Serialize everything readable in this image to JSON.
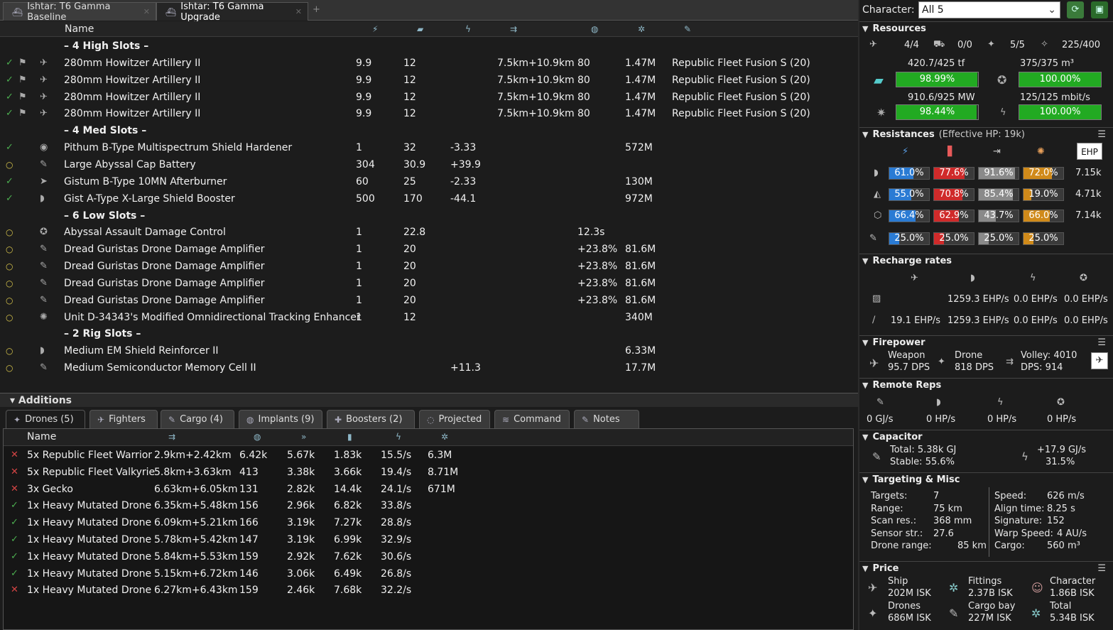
{
  "tabs": [
    {
      "label": "Ishtar: T6 Gamma Baseline"
    },
    {
      "label": "Ishtar: T6 Gamma Upgrade"
    }
  ],
  "fit_header": {
    "name": "Name"
  },
  "sections": {
    "high": "– 4 High Slots –",
    "med": "– 4 Med Slots –",
    "low": "– 6 Low Slots –",
    "rig": "– 2 Rig Slots –"
  },
  "modules": [
    {
      "state": "✓",
      "name": "280mm Howitzer Artillery II",
      "c1": "9.9",
      "c2": "12",
      "c3": "",
      "c4": "7.5km+10.9km",
      "c5": "80",
      "c6": "1.47M",
      "c7": "Republic Fleet Fusion S (20)"
    },
    {
      "state": "✓",
      "name": "280mm Howitzer Artillery II",
      "c1": "9.9",
      "c2": "12",
      "c3": "",
      "c4": "7.5km+10.9km",
      "c5": "80",
      "c6": "1.47M",
      "c7": "Republic Fleet Fusion S (20)"
    },
    {
      "state": "✓",
      "name": "280mm Howitzer Artillery II",
      "c1": "9.9",
      "c2": "12",
      "c3": "",
      "c4": "7.5km+10.9km",
      "c5": "80",
      "c6": "1.47M",
      "c7": "Republic Fleet Fusion S (20)"
    },
    {
      "state": "✓",
      "name": "280mm Howitzer Artillery II",
      "c1": "9.9",
      "c2": "12",
      "c3": "",
      "c4": "7.5km+10.9km",
      "c5": "80",
      "c6": "1.47M",
      "c7": "Republic Fleet Fusion S (20)"
    },
    {
      "state": "✓",
      "name": "Pithum B-Type Multispectrum Shield Hardener",
      "c1": "1",
      "c2": "32",
      "c3": "-3.33",
      "c4": "",
      "c5": "",
      "c6": "572M",
      "c7": ""
    },
    {
      "state": "○",
      "name": "Large Abyssal Cap Battery",
      "c1": "304",
      "c2": "30.9",
      "c3": "+39.9",
      "c4": "",
      "c5": "",
      "c6": "",
      "c7": ""
    },
    {
      "state": "✓",
      "name": "Gistum B-Type 10MN Afterburner",
      "c1": "60",
      "c2": "25",
      "c3": "-2.33",
      "c4": "",
      "c5": "",
      "c6": "130M",
      "c7": ""
    },
    {
      "state": "✓",
      "name": "Gist A-Type X-Large Shield Booster",
      "c1": "500",
      "c2": "170",
      "c3": "-44.1",
      "c4": "",
      "c5": "",
      "c6": "972M",
      "c7": ""
    },
    {
      "state": "○",
      "name": "Abyssal Assault Damage Control",
      "c1": "1",
      "c2": "22.8",
      "c3": "",
      "c4": "",
      "c5": "12.3s",
      "c6": "",
      "c7": ""
    },
    {
      "state": "○",
      "name": "Dread Guristas Drone Damage Amplifier",
      "c1": "1",
      "c2": "20",
      "c3": "",
      "c4": "",
      "c5": "+23.8%",
      "c6": "81.6M",
      "c7": ""
    },
    {
      "state": "○",
      "name": "Dread Guristas Drone Damage Amplifier",
      "c1": "1",
      "c2": "20",
      "c3": "",
      "c4": "",
      "c5": "+23.8%",
      "c6": "81.6M",
      "c7": ""
    },
    {
      "state": "○",
      "name": "Dread Guristas Drone Damage Amplifier",
      "c1": "1",
      "c2": "20",
      "c3": "",
      "c4": "",
      "c5": "+23.8%",
      "c6": "81.6M",
      "c7": ""
    },
    {
      "state": "○",
      "name": "Dread Guristas Drone Damage Amplifier",
      "c1": "1",
      "c2": "20",
      "c3": "",
      "c4": "",
      "c5": "+23.8%",
      "c6": "81.6M",
      "c7": ""
    },
    {
      "state": "○",
      "name": "Unit D-34343's Modified Omnidirectional Tracking Enhancer",
      "c1": "1",
      "c2": "12",
      "c3": "",
      "c4": "",
      "c5": "",
      "c6": "340M",
      "c7": ""
    },
    {
      "state": "○",
      "name": "Medium EM Shield Reinforcer II",
      "c1": "",
      "c2": "",
      "c3": "",
      "c4": "",
      "c5": "",
      "c6": "6.33M",
      "c7": ""
    },
    {
      "state": "○",
      "name": "Medium Semiconductor Memory Cell II",
      "c1": "",
      "c2": "",
      "c3": "+11.3",
      "c4": "",
      "c5": "",
      "c6": "17.7M",
      "c7": ""
    }
  ],
  "additions": {
    "title": "Additions",
    "tabs": [
      "Drones (5)",
      "Fighters",
      "Cargo (4)",
      "Implants (9)",
      "Boosters (2)",
      "Projected",
      "Command",
      "Notes"
    ],
    "name_header": "Name",
    "drones": [
      {
        "state": "✕",
        "name": "5x Republic Fleet Warrior",
        "range": "2.9km+2.42km",
        "c1": "6.42k",
        "c2": "5.67k",
        "c3": "1.83k",
        "c4": "15.5/s",
        "c5": "6.3M"
      },
      {
        "state": "✕",
        "name": "5x Republic Fleet Valkyrie",
        "range": "5.8km+3.63km",
        "c1": "413",
        "c2": "3.38k",
        "c3": "3.66k",
        "c4": "19.4/s",
        "c5": "8.71M"
      },
      {
        "state": "✕",
        "name": "3x Gecko",
        "range": "6.63km+6.05km",
        "c1": "131",
        "c2": "2.82k",
        "c3": "14.4k",
        "c4": "24.1/s",
        "c5": "671M"
      },
      {
        "state": "✓",
        "name": "1x Heavy Mutated Drone",
        "range": "6.35km+5.48km",
        "c1": "156",
        "c2": "2.96k",
        "c3": "6.82k",
        "c4": "33.8/s",
        "c5": ""
      },
      {
        "state": "✓",
        "name": "1x Heavy Mutated Drone",
        "range": "6.09km+5.21km",
        "c1": "166",
        "c2": "3.19k",
        "c3": "7.27k",
        "c4": "28.8/s",
        "c5": ""
      },
      {
        "state": "✓",
        "name": "1x Heavy Mutated Drone",
        "range": "5.78km+5.42km",
        "c1": "147",
        "c2": "3.19k",
        "c3": "6.99k",
        "c4": "32.9/s",
        "c5": ""
      },
      {
        "state": "✓",
        "name": "1x Heavy Mutated Drone",
        "range": "5.84km+5.53km",
        "c1": "159",
        "c2": "2.92k",
        "c3": "7.62k",
        "c4": "30.6/s",
        "c5": ""
      },
      {
        "state": "✓",
        "name": "1x Heavy Mutated Drone",
        "range": "5.15km+6.72km",
        "c1": "146",
        "c2": "3.06k",
        "c3": "6.49k",
        "c4": "26.8/s",
        "c5": ""
      },
      {
        "state": "✕",
        "name": "1x Heavy Mutated Drone",
        "range": "6.27km+6.43km",
        "c1": "159",
        "c2": "2.46k",
        "c3": "7.68k",
        "c4": "32.2/s",
        "c5": ""
      }
    ]
  },
  "character": {
    "label": "Character:",
    "value": "All 5"
  },
  "resources": {
    "title": "Resources",
    "r1": "4/4",
    "r2": "0/0",
    "r3": "5/5",
    "r4": "225/400",
    "cpu_label": "420.7/425 tf",
    "cpu_pct": "98.99%",
    "cpu_fill": 0.9899,
    "cargo_label": "375/375 m³",
    "cargo_pct": "100.00%",
    "cargo_fill": 1.0,
    "pg_label": "910.6/925 MW",
    "pg_pct": "98.44%",
    "pg_fill": 0.9844,
    "bw_label": "125/125 mbit/s",
    "bw_pct": "100.00%",
    "bw_fill": 1.0
  },
  "resistances": {
    "title": "Resistances",
    "subtitle": "(Effective HP: 19k)",
    "ehp_button": "EHP",
    "rows": [
      {
        "vals": [
          "61.0%",
          "77.6%",
          "91.6%",
          "72.0%"
        ],
        "fills": [
          0.61,
          0.776,
          0.916,
          0.72
        ],
        "ehp": "7.15k"
      },
      {
        "vals": [
          "55.0%",
          "70.8%",
          "85.4%",
          "19.0%"
        ],
        "fills": [
          0.55,
          0.708,
          0.854,
          0.19
        ],
        "ehp": "4.71k"
      },
      {
        "vals": [
          "66.4%",
          "62.9%",
          "43.7%",
          "66.0%"
        ],
        "fills": [
          0.664,
          0.629,
          0.437,
          0.66
        ],
        "ehp": "7.14k"
      },
      {
        "vals": [
          "25.0%",
          "25.0%",
          "25.0%",
          "25.0%"
        ],
        "fills": [
          0.25,
          0.25,
          0.25,
          0.25
        ],
        "ehp": ""
      }
    ],
    "colors": [
      "#2a7bd4",
      "#d02a2a",
      "#8a8a8a",
      "#d08a1a"
    ]
  },
  "recharge": {
    "title": "Recharge rates",
    "r1": [
      "",
      "1259.3 EHP/s",
      "0.0 EHP/s",
      "0.0 EHP/s"
    ],
    "r2": [
      "19.1 EHP/s",
      "1259.3 EHP/s",
      "0.0 EHP/s",
      "0.0 EHP/s"
    ]
  },
  "firepower": {
    "title": "Firepower",
    "weapon_label": "Weapon",
    "weapon_dps": "95.7 DPS",
    "drone_label": "Drone",
    "drone_dps": "818 DPS",
    "volley": "Volley: 4010",
    "dps": "DPS: 914"
  },
  "remote": {
    "title": "Remote Reps",
    "v1": "0 GJ/s",
    "v2": "0 HP/s",
    "v3": "0 HP/s",
    "v4": "0 HP/s"
  },
  "capacitor": {
    "title": "Capacitor",
    "total": "Total: 5.38k GJ",
    "stable": "Stable: 55.6%",
    "delta": "+17.9 GJ/s",
    "pct": "31.5%"
  },
  "targeting": {
    "title": "Targeting & Misc",
    "left": [
      [
        "Targets:",
        "7"
      ],
      [
        "Range:",
        "75 km"
      ],
      [
        "Scan res.:",
        "368 mm"
      ],
      [
        "Sensor str.:",
        "27.6"
      ],
      [
        "Drone range:",
        "85 km"
      ]
    ],
    "right": [
      [
        "Speed:",
        "626 m/s"
      ],
      [
        "Align time:",
        "8.25 s"
      ],
      [
        "Signature:",
        "152"
      ],
      [
        "Warp Speed:",
        "4 AU/s"
      ],
      [
        "Cargo:",
        "560 m³"
      ]
    ]
  },
  "price": {
    "title": "Price",
    "ship_l": "Ship",
    "ship_v": "202M ISK",
    "fit_l": "Fittings",
    "fit_v": "2.37B ISK",
    "char_l": "Character",
    "char_v": "1.86B ISK",
    "drones_l": "Drones",
    "drones_v": "686M ISK",
    "cargo_l": "Cargo bay",
    "cargo_v": "227M ISK",
    "total_l": "Total",
    "total_v": "5.34B ISK"
  }
}
